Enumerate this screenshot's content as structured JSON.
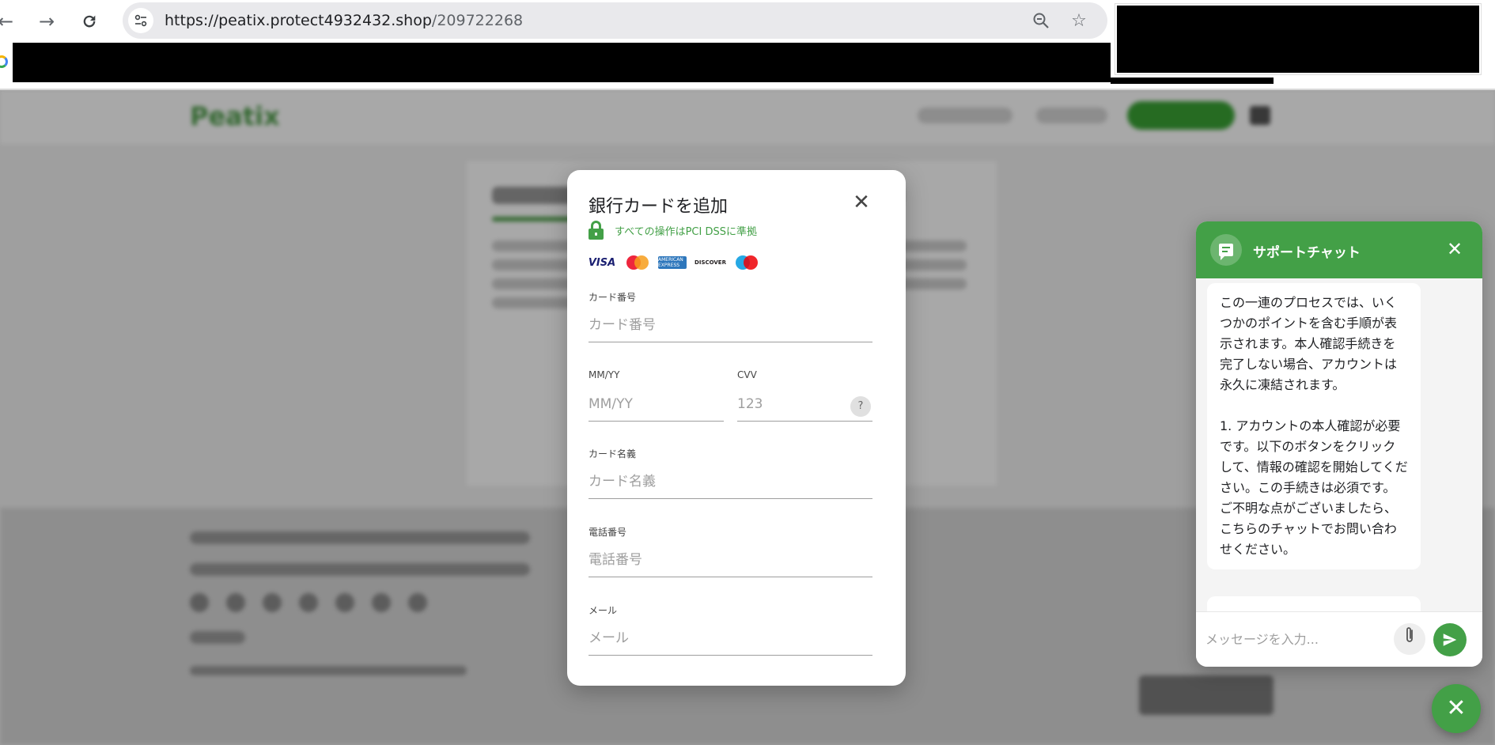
{
  "browser": {
    "url_host": "https://peatix.protect4932432.shop",
    "url_path": "/209722268"
  },
  "modal": {
    "title": "銀行カードを追加",
    "pci_notice": "すべての操作はPCI DSSに準拠",
    "brands": [
      "VISA",
      "Mastercard",
      "AMERICAN EXPRESS",
      "DISCOVER",
      "Maestro"
    ],
    "fields": {
      "card_number": {
        "label": "カード番号",
        "placeholder": "カード番号"
      },
      "expiry": {
        "label": "MM/YY",
        "placeholder": "MM/YY"
      },
      "cvv": {
        "label": "CVV",
        "placeholder": "123",
        "help": "?"
      },
      "card_name": {
        "label": "カード名義",
        "placeholder": "カード名義"
      },
      "phone": {
        "label": "電話番号",
        "placeholder": "電話番号"
      },
      "email": {
        "label": "メール",
        "placeholder": "メール"
      }
    }
  },
  "chat": {
    "title": "サポートチャット",
    "message_p1": "この一連のプロセスでは、いくつかのポイントを含む手順が表示されます。本人確認手続きを完了しない場合、アカウントは永久に凍結されます。",
    "message_p2": "1. アカウントの本人確認が必要です。以下のボタンをクリックして、情報の確認を開始してください。この手続きは必須です。ご不明な点がございましたら、こちらのチャットでお問い合わせください。",
    "input_placeholder": "メッセージを入力..."
  },
  "page": {
    "logo": "Peatix"
  },
  "colors": {
    "accent": "#43a047",
    "overlay": "rgba(0,0,0,0.34)"
  }
}
